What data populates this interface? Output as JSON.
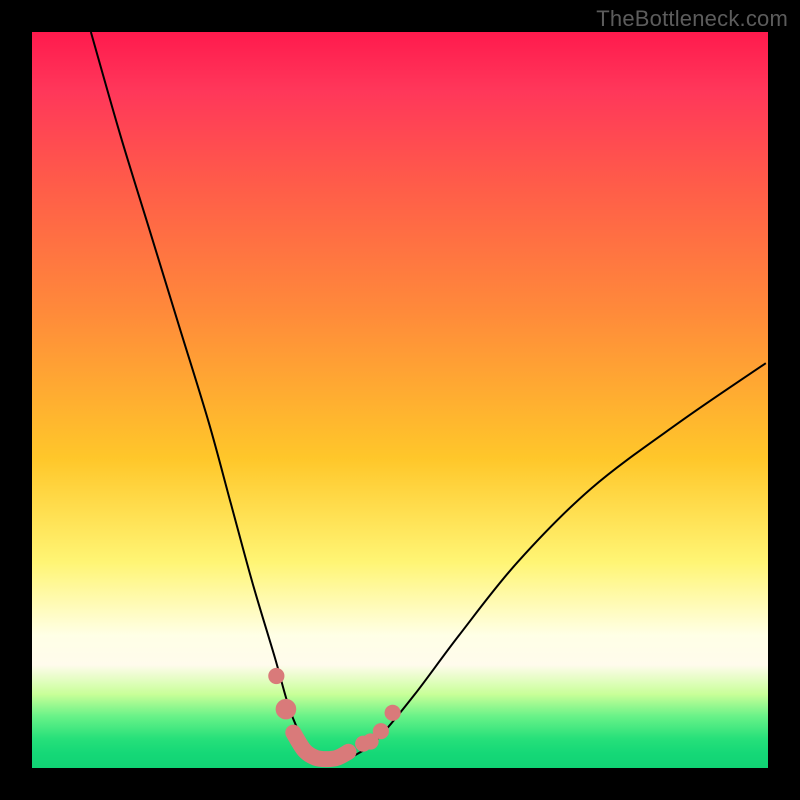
{
  "watermark": "TheBottleneck.com",
  "colors": {
    "background": "#000000",
    "gradient_top": "#ff1a4d",
    "gradient_mid": "#ffc72a",
    "gradient_bottom_green": "#15d877",
    "curve_stroke": "#000000",
    "marker_fill": "#d97a7a"
  },
  "chart_data": {
    "type": "line",
    "title": "",
    "xlabel": "",
    "ylabel": "",
    "xlim": [
      0,
      100
    ],
    "ylim": [
      0,
      100
    ],
    "grid": false,
    "legend": false,
    "note": "No axis ticks or labels are visible; x and y use 0–100 normalized coordinates inferred from pixel positions. y=0 is the bottom of the plot, y=100 is the top.",
    "series": [
      {
        "name": "curve",
        "x": [
          8,
          12,
          16,
          20,
          24,
          27,
          30,
          33,
          35,
          37,
          38.5,
          40,
          42,
          44,
          47,
          52,
          58,
          66,
          76,
          88,
          99.7
        ],
        "y": [
          100,
          86,
          73,
          60,
          47,
          36,
          25,
          15,
          8,
          3.5,
          1.8,
          1.2,
          1.2,
          1.8,
          4,
          10,
          18,
          28,
          38,
          47,
          55
        ]
      }
    ],
    "markers": [
      {
        "x": 33.2,
        "y": 12.5,
        "r": 1.1
      },
      {
        "x": 34.5,
        "y": 8.0,
        "r": 1.4
      },
      {
        "x": 45.0,
        "y": 3.3,
        "r": 1.1
      },
      {
        "x": 46.0,
        "y": 3.6,
        "r": 1.1
      },
      {
        "x": 47.4,
        "y": 5.0,
        "r": 1.1
      },
      {
        "x": 49.0,
        "y": 7.5,
        "r": 1.1
      }
    ],
    "thick_bottom_segment": {
      "x": [
        35.5,
        37.0,
        38.5,
        40.0,
        41.5,
        43.0
      ],
      "y": [
        4.8,
        2.4,
        1.4,
        1.2,
        1.4,
        2.2
      ]
    }
  }
}
